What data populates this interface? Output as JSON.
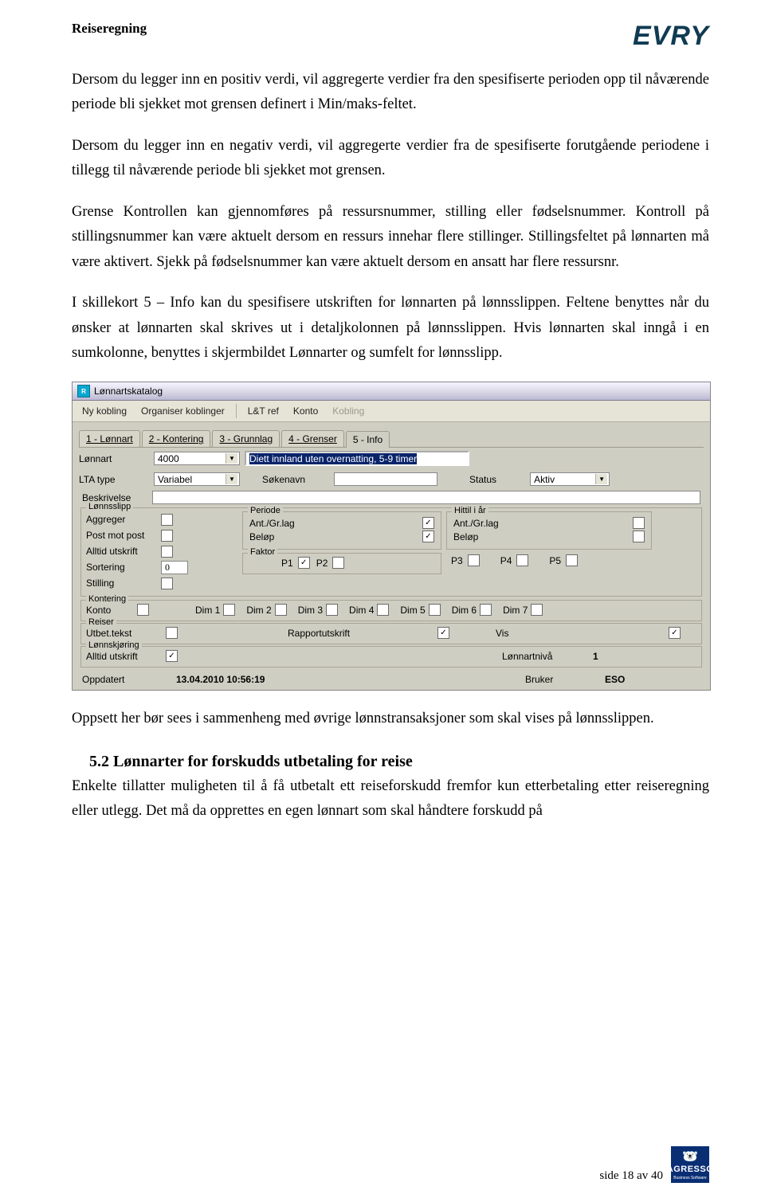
{
  "header": {
    "title": "Reiseregning",
    "logo": "EVRY"
  },
  "p1": "Dersom du legger inn en positiv verdi, vil aggregerte verdier fra den spesifiserte perioden opp til nåværende periode bli sjekket mot grensen definert i Min/maks-feltet.",
  "p2": "Dersom du legger inn en negativ verdi, vil aggregerte verdier fra de spesifiserte forutgående periodene i tillegg til nåværende periode bli sjekket mot grensen.",
  "p3": "Grense Kontrollen kan gjennomføres på ressursnummer, stilling eller fødselsnummer. Kontroll på stillingsnummer kan være aktuelt dersom en ressurs innehar flere stillinger. Stillingsfeltet på lønnarten må være aktivert. Sjekk på fødselsnummer kan være aktuelt dersom en ansatt har flere ressursnr.",
  "p4": "I skillekort 5 – Info kan du spesifisere utskriften for lønnarten på lønnsslippen. Feltene benyttes når du ønsker at lønnarten skal skrives ut i detaljkolonnen på lønnsslippen. Hvis lønnarten skal inngå i en sumkolonne, benyttes i skjermbildet Lønnarter og sumfelt for lønnsslipp.",
  "p5": "Oppsett her bør sees i sammenheng med øvrige lønnstransaksjoner som skal vises på lønnsslippen.",
  "h2": "5.2  Lønnarter for forskudds utbetaling for reise",
  "p6": "Enkelte tillatter muligheten til å få utbetalt ett reiseforskudd fremfor kun etterbetaling etter reiseregning eller utlegg. Det må da opprettes en egen lønnart som skal håndtere forskudd på",
  "app": {
    "title": "Lønnartskatalog",
    "toolbar": {
      "nykobling": "Ny kobling",
      "organiser": "Organiser koblinger",
      "ltref": "L&T ref",
      "konto": "Konto",
      "kobling": "Kobling"
    },
    "tabs": [
      "1 - Lønnart",
      "2 - Kontering",
      "3 - Grunnlag",
      "4 - Grenser",
      "5 - Info"
    ],
    "active_tab": 4,
    "lonnart_lbl": "Lønnart",
    "lonnart_val": "4000",
    "lonnart_desc": "Diett innland uten overnatting, 5-9 timer",
    "lta_lbl": "LTA type",
    "lta_val": "Variabel",
    "sokenavn_lbl": "Søkenavn",
    "sokenavn_val": "",
    "status_lbl": "Status",
    "status_val": "Aktiv",
    "beskrivelse_lbl": "Beskrivelse",
    "grp_lonnsslipp": "Lønnsslipp",
    "aggreger": "Aggreger",
    "postmotpost": "Post mot post",
    "alltid_utskrift": "Alltid utskrift",
    "sortering": "Sortering",
    "sortering_val": "0",
    "stilling": "Stilling",
    "grp_periode": "Periode",
    "antgrlag": "Ant./Gr.lag",
    "belop": "Beløp",
    "grp_hittil": "Hittil i år",
    "grp_faktor": "Faktor",
    "p": [
      "P1",
      "P2",
      "P3",
      "P4",
      "P5"
    ],
    "grp_kontering": "Kontering",
    "konto_lbl": "Konto",
    "dims": [
      "Dim 1",
      "Dim 2",
      "Dim 3",
      "Dim 4",
      "Dim 5",
      "Dim 6",
      "Dim 7"
    ],
    "grp_reiser": "Reiser",
    "utbet_tekst": "Utbet.tekst",
    "rapportutskrift": "Rapportutskrift",
    "vis": "Vis",
    "grp_lonnskjoring": "Lønnskjøring",
    "lonnartniva": "Lønnartnivå",
    "lonnartniva_val": "1",
    "oppdatert_lbl": "Oppdatert",
    "oppdatert_val": "13.04.2010 10:56:19",
    "bruker_lbl": "Bruker",
    "bruker_val": "ESO"
  },
  "footer": {
    "page": "side 18 av 40",
    "logo_top": "AGRESSO",
    "logo_bottom": "Business Software"
  }
}
